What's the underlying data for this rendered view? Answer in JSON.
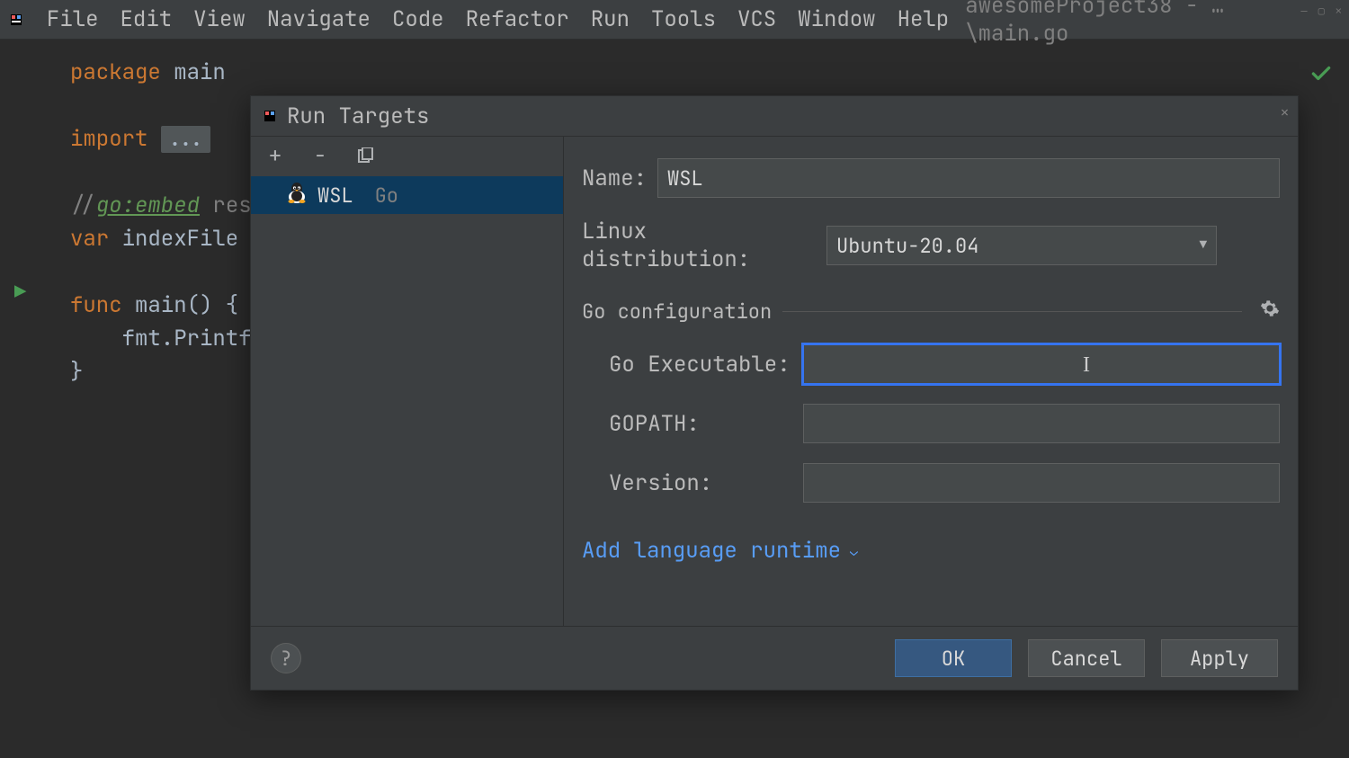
{
  "menubar": {
    "items": [
      "File",
      "Edit",
      "View",
      "Navigate",
      "Code",
      "Refactor",
      "Run",
      "Tools",
      "VCS",
      "Window",
      "Help"
    ],
    "project_info": "awesomeProject38 - …\\main.go"
  },
  "editor": {
    "lines": {
      "l1_kw": "package",
      "l1_name": "main",
      "l3_kw": "import",
      "l3_dots": "...",
      "l5_comment": "//",
      "l5_embed": "go:embed",
      "l5_rest": " res",
      "l6_kw": "var",
      "l6_rest": " indexFile s",
      "l8_kw": "func",
      "l8_fn": " main() {",
      "l9_call": "    fmt.Printf(",
      "l10_brace": "}"
    }
  },
  "dialog": {
    "title": "Run Targets",
    "toolbar": {
      "add": "+",
      "remove": "−",
      "copy": "⧉"
    },
    "tree": {
      "item_label": "WSL",
      "item_kind": "Go"
    },
    "form": {
      "name_label": "Name:",
      "name_value": "WSL",
      "dist_label": "Linux distribution:",
      "dist_value": "Ubuntu-20.04",
      "section": "Go configuration",
      "go_exec_label": "Go Executable:",
      "go_exec_value": "",
      "gopath_label": "GOPATH:",
      "gopath_value": "",
      "version_label": "Version:",
      "version_value": "",
      "add_runtime": "Add language runtime"
    },
    "buttons": {
      "ok": "OK",
      "cancel": "Cancel",
      "apply": "Apply",
      "help": "?"
    }
  }
}
